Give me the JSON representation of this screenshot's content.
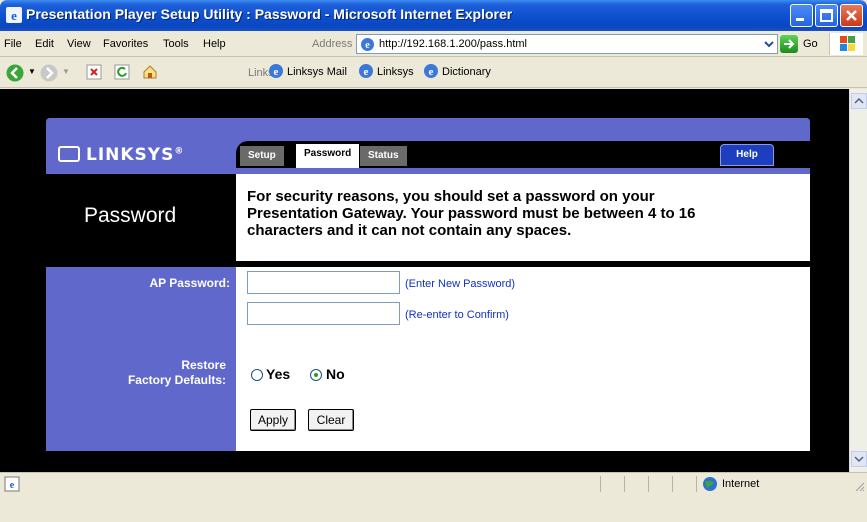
{
  "window": {
    "title": "Presentation Player Setup Utility : Password - Microsoft Internet Explorer"
  },
  "menu": {
    "items": [
      "File",
      "Edit",
      "View",
      "Favorites",
      "Tools",
      "Help"
    ],
    "address_label": "Address",
    "url": "http://192.168.1.200/pass.html",
    "go_label": "Go"
  },
  "toolbar": {
    "links_label": "Links",
    "links": [
      "Linksys Mail",
      "Linksys",
      "Dictionary"
    ]
  },
  "page": {
    "logo": "LINKSYS",
    "logo_mark": "®",
    "tabs": [
      "Setup",
      "Password",
      "Status"
    ],
    "active_tab": "Password",
    "help_label": "Help",
    "title": "Password",
    "intro": "For security reasons, you should set a password on your Presentation Gateway. Your password must be between 4 to 16 characters and it can not contain any spaces.",
    "ap_password_label": "AP Password:",
    "new_password_hint": "(Enter New Password)",
    "confirm_password_hint": "(Re-enter to Confirm)",
    "new_password_value": "",
    "confirm_password_value": "",
    "restore_label_line1": "Restore",
    "restore_label_line2": "Factory Defaults:",
    "radio_yes": "Yes",
    "radio_no": "No",
    "restore_selected": "No",
    "apply_label": "Apply",
    "clear_label": "Clear"
  },
  "status": {
    "zone": "Internet"
  },
  "colors": {
    "panel_blue": "#6068cc",
    "help_blue": "#1e3ec0",
    "hint_blue": "#1030c0",
    "title_bar": "#0b4fd0"
  }
}
